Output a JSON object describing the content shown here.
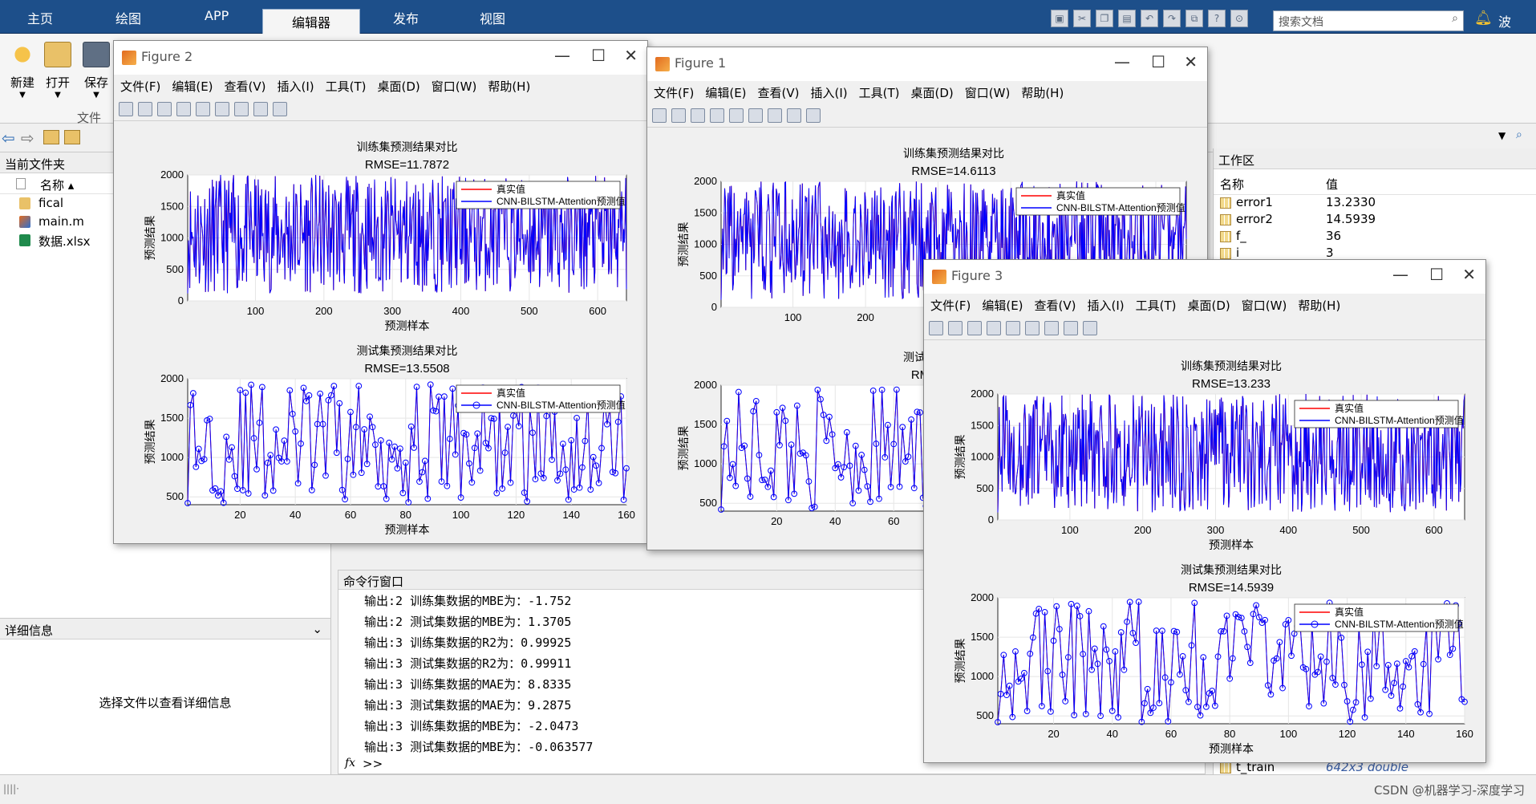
{
  "ribbon": {
    "tabs": [
      "主页",
      "绘图",
      "APP",
      "编辑器",
      "发布",
      "视图"
    ],
    "search_placeholder": "搜索文档",
    "user": "波"
  },
  "toolstrip": {
    "tools": [
      "新建",
      "打开",
      "保存"
    ],
    "section": "文件"
  },
  "file_panel": {
    "title": "当前文件夹",
    "column": "名称",
    "items": [
      {
        "name": "fical",
        "type": "folder"
      },
      {
        "name": "main.m",
        "type": "m"
      },
      {
        "name": "数据.xlsx",
        "type": "xlsx"
      }
    ]
  },
  "details_panel": {
    "title": "详细信息",
    "message": "选择文件以查看详细信息"
  },
  "command_window": {
    "title": "命令行窗口",
    "lines": [
      "输出:2  训练集数据的MBE为：-1.752",
      "输出:2  测试集数据的MBE为：1.3705",
      "输出:3  训练集数据的R2为：0.99925",
      "输出:3  测试集数据的R2为：0.99911",
      "输出:3  训练集数据的MAE为：8.8335",
      "输出:3  测试集数据的MAE为：9.2875",
      "输出:3  训练集数据的MBE为：-2.0473",
      "输出:3  测试集数据的MBE为：-0.063577"
    ],
    "prompt": ">>",
    "fx": "fx"
  },
  "workspace": {
    "title": "工作区",
    "col_name": "名称",
    "col_value": "值",
    "vars": [
      {
        "name": "error1",
        "value": "13.2330"
      },
      {
        "name": "error2",
        "value": "14.5939"
      },
      {
        "name": "f_",
        "value": "36"
      },
      {
        "name": "i",
        "value": "3"
      }
    ],
    "bottom_var": {
      "name": "t_train",
      "value": "642x3 double"
    }
  },
  "watermark": "CSDN @机器学习-深度学习",
  "figure_menu": [
    "文件(F)",
    "编辑(E)",
    "查看(V)",
    "插入(I)",
    "工具(T)",
    "桌面(D)",
    "窗口(W)",
    "帮助(H)"
  ],
  "figures": [
    {
      "title": "Figure 2",
      "train_title": "训练集预测结果对比",
      "train_rmse": "RMSE=11.7872",
      "test_title": "测试集预测结果对比",
      "test_rmse": "RMSE=13.5508"
    },
    {
      "title": "Figure 1",
      "train_title": "训练集预测结果对比",
      "train_rmse": "RMSE=14.6113",
      "test_title": "测试集预测结果对比",
      "test_rmse": "RMSE=14.5939"
    },
    {
      "title": "Figure 3",
      "train_title": "训练集预测结果对比",
      "train_rmse": "RMSE=13.233",
      "test_title": "测试集预测结果对比",
      "test_rmse": "RMSE=14.5939"
    }
  ],
  "legend": {
    "true": "真实值",
    "pred": "CNN-BILSTM-Attention预测值"
  },
  "axis": {
    "xlabel": "预测样本",
    "ylabel": "预测结果"
  },
  "chart_data": [
    {
      "type": "line",
      "panel": "train",
      "xlim": [
        1,
        642
      ],
      "ylim": [
        0,
        2000
      ],
      "xticks": [
        100,
        200,
        300,
        400,
        500,
        600
      ],
      "yticks": [
        0,
        500,
        1000,
        1500,
        2000
      ],
      "colors": {
        "true": "#ff0000",
        "pred": "#0000ff"
      }
    },
    {
      "type": "line",
      "panel": "test",
      "xlim": [
        1,
        160
      ],
      "ylim": [
        400,
        2000
      ],
      "xticks": [
        20,
        40,
        60,
        80,
        100,
        120,
        140,
        160
      ],
      "yticks": [
        500,
        1000,
        1500,
        2000
      ],
      "markers": "circle",
      "colors": {
        "true": "#ff0000",
        "pred": "#0000ff"
      }
    }
  ]
}
